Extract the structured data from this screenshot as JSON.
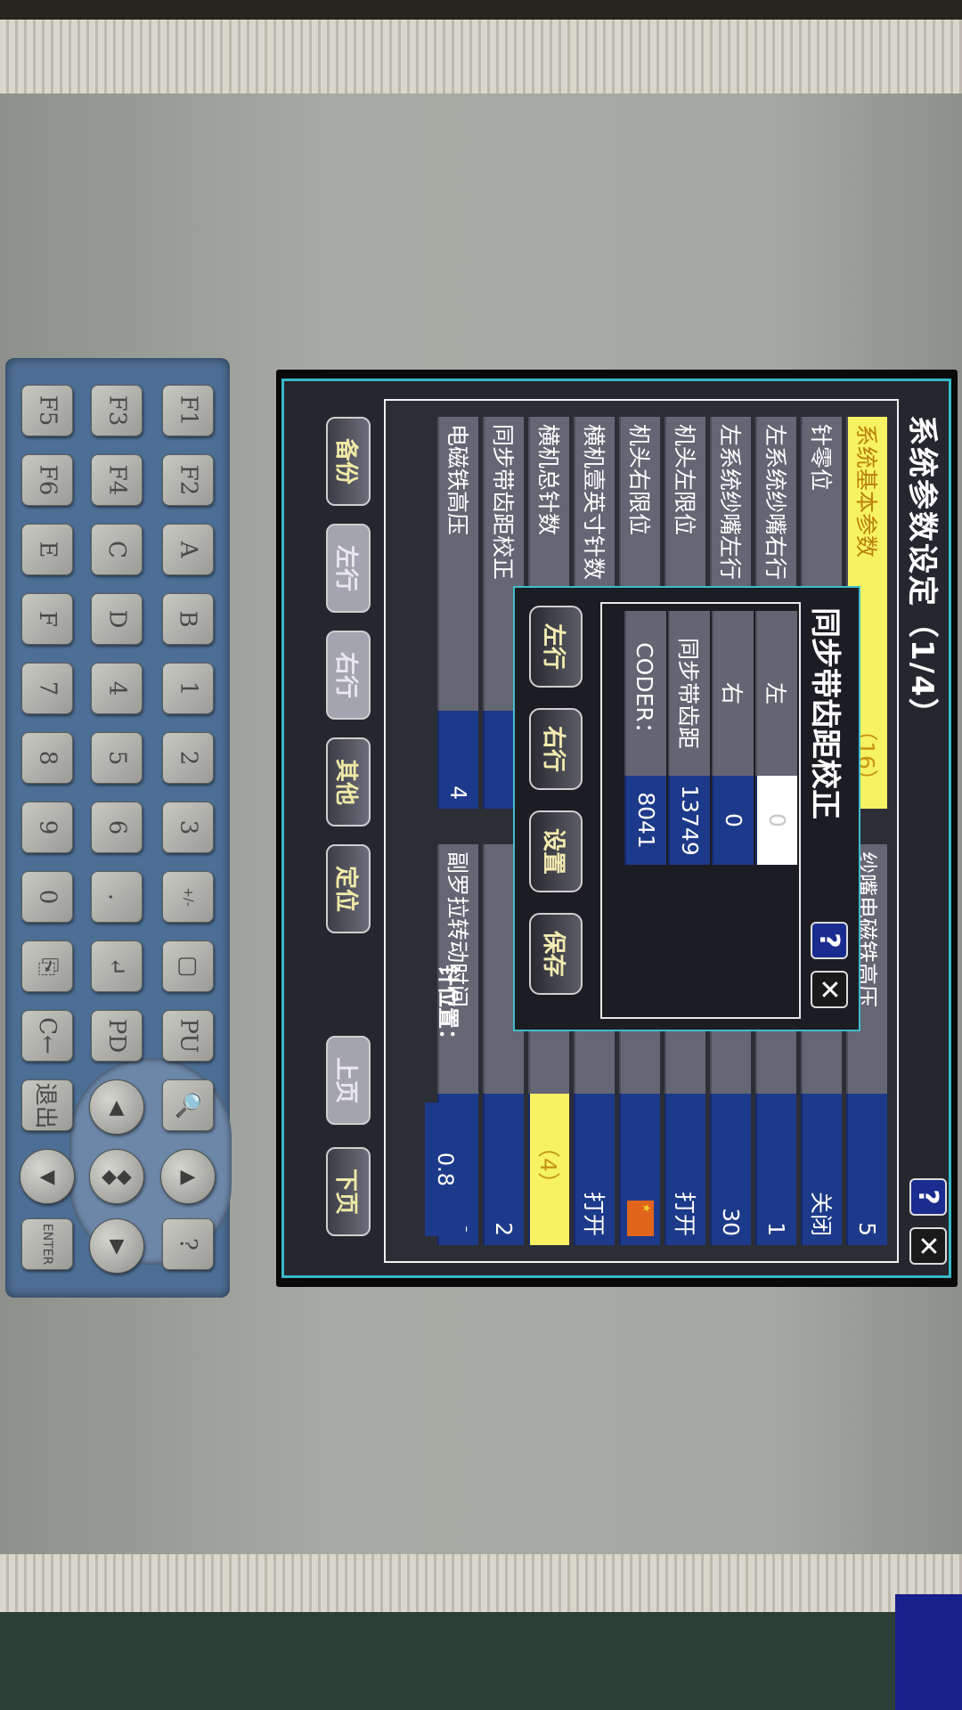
{
  "screen": {
    "title": "系统参数设定（1/4）",
    "left_rows": [
      {
        "label": "系统基本参数",
        "value": "（16）",
        "highlight": true
      },
      {
        "label": "针零位",
        "value": "",
        "highlight": false
      },
      {
        "label": "左系统纱嘴右行",
        "value": "",
        "highlight": false
      },
      {
        "label": "左系统纱嘴左行",
        "value": "",
        "highlight": false
      },
      {
        "label": "机头左限位",
        "value": "",
        "highlight": false
      },
      {
        "label": "机头右限位",
        "value": "",
        "highlight": false
      },
      {
        "label": "横机壹英寸针数",
        "value": "",
        "highlight": false
      },
      {
        "label": "横机总针数",
        "value": "",
        "highlight": false
      },
      {
        "label": "同步带齿距校正",
        "value": "",
        "highlight": false
      },
      {
        "label": "电磁铁高压",
        "value": "4",
        "highlight": false
      }
    ],
    "right_rows": [
      {
        "label": "纱嘴电磁铁高压",
        "value": "5",
        "highlight": false
      },
      {
        "label": "",
        "value": "关闭",
        "highlight": false
      },
      {
        "label": "",
        "value": "1",
        "highlight": false
      },
      {
        "label": "",
        "value": "30",
        "highlight": false
      },
      {
        "label": "",
        "value": "打开",
        "highlight": false
      },
      {
        "label": "",
        "value": "",
        "highlight": false,
        "flag": true
      },
      {
        "label": "",
        "value": "打开",
        "highlight": false
      },
      {
        "label": "",
        "value": "（4）",
        "highlight": true
      },
      {
        "label": "",
        "value": "2",
        "highlight": false
      },
      {
        "label": "副罗拉转动时间",
        "value": "0",
        "highlight": false
      }
    ],
    "needle_position_label": "针位置：",
    "needle_position_value": "0.8",
    "bottom_buttons": {
      "backup": "备份",
      "left": "左行",
      "right": "右行",
      "other": "其他",
      "locate": "定位",
      "prev": "上页",
      "next": "下页"
    }
  },
  "dialog": {
    "title": "同步带齿距校正",
    "rows": [
      {
        "label": "左",
        "value": "0"
      },
      {
        "label": "右",
        "value": "0"
      },
      {
        "label": "同步带齿距",
        "value": "13749"
      },
      {
        "label": "CODER：",
        "value": "8041"
      }
    ],
    "buttons": {
      "left": "左行",
      "right": "右行",
      "set": "设置",
      "save": "保存"
    }
  },
  "keypad": {
    "rows": [
      [
        "F1",
        "F2",
        "A",
        "B",
        "1",
        "2",
        "3",
        "+/-",
        "▢",
        "PU",
        "🔍",
        "▶",
        "?"
      ],
      [
        "F3",
        "F4",
        "C",
        "D",
        "4",
        "5",
        "6",
        ".",
        "↵",
        "PD",
        "▲",
        "◆◆",
        "▼"
      ],
      [
        "F5",
        "F6",
        "E",
        "F",
        "7",
        "8",
        "9",
        "0",
        "⎘",
        "C←",
        "退出",
        "◀",
        "ENTER"
      ]
    ]
  },
  "colors": {
    "highlight_yellow": "#f7f261",
    "value_blue": "#1d3a8a",
    "label_gray": "#646572",
    "screen_border": "#36b9c9"
  }
}
